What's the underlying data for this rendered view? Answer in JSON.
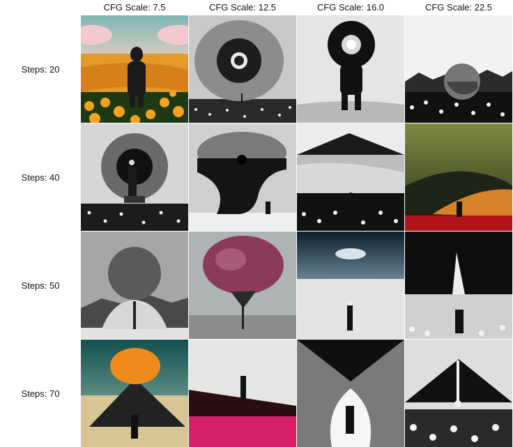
{
  "columns": [
    "CFG Scale: 7.5",
    "CFG Scale: 12.5",
    "CFG Scale: 16.0",
    "CFG Scale: 22.5"
  ],
  "rows": [
    "Steps: 20",
    "Steps: 40",
    "Steps: 50",
    "Steps: 70"
  ],
  "palette": {
    "flower_orange": "#f29a1e",
    "flower_pink": "#8a2a4a",
    "red_field": "#c0141a",
    "teal_sky": "#1f6a6a",
    "olive_sky": "#6b6f3a",
    "sand": "#d9c49a"
  }
}
